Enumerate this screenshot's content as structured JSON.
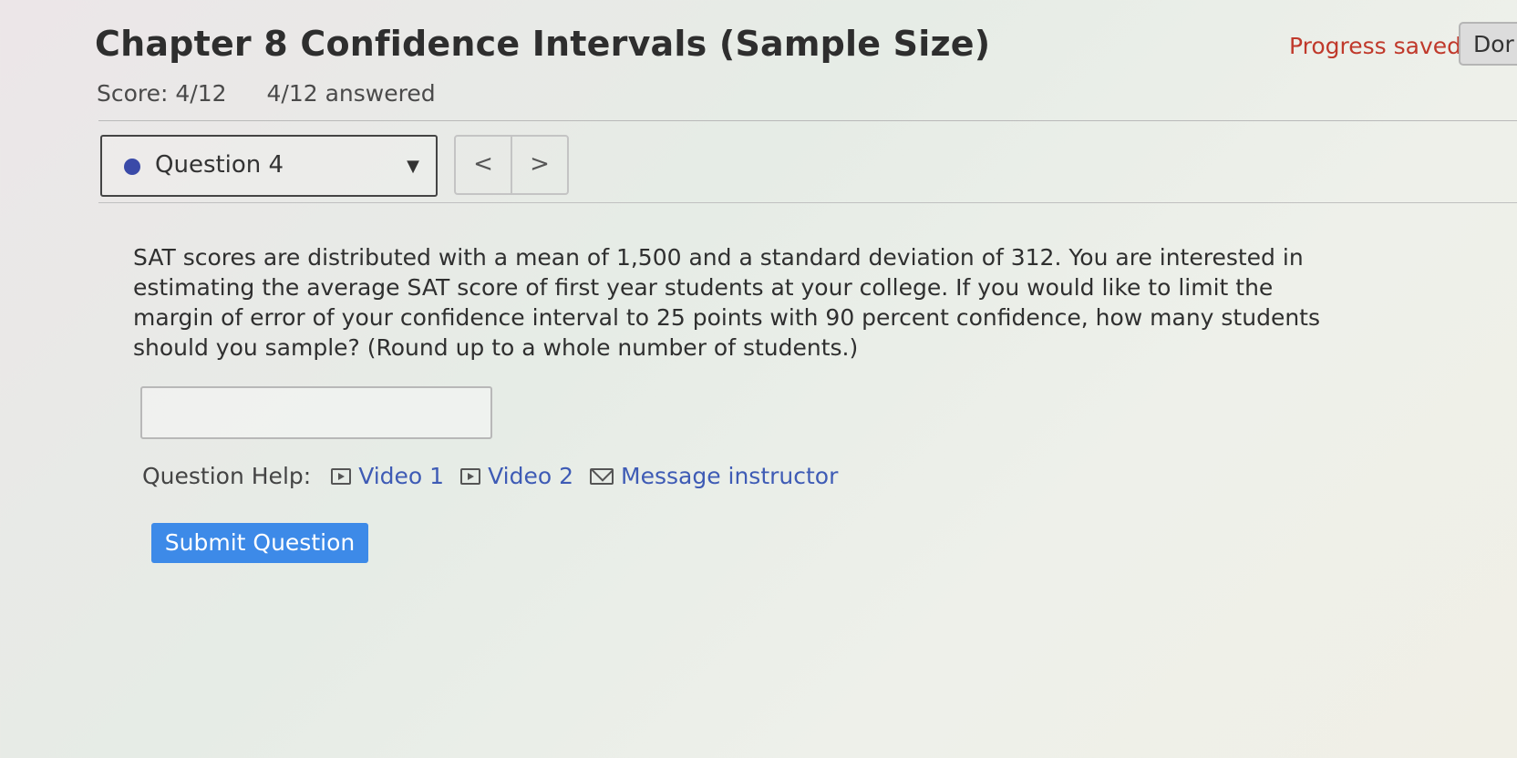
{
  "header": {
    "title": "Chapter 8 Confidence Intervals (Sample Size)",
    "score": "Score: 4/12",
    "answered": "4/12 answered",
    "progress_status": "Progress saved",
    "done_label": "Dor"
  },
  "question_nav": {
    "selected_question": "Question 4",
    "prev_label": "<",
    "next_label": ">"
  },
  "question": {
    "text": "SAT scores are distributed with a mean of 1,500 and a standard deviation of 312. You are interested in estimating the average SAT score of first year students at your college. If you would like to limit the margin of error of your confidence interval to 25 points with 90 percent confidence, how many students should you sample?  (Round up to a whole number of students.)",
    "answer_value": ""
  },
  "help": {
    "label": "Question Help:",
    "video1": "Video 1",
    "video2": "Video 2",
    "message": "Message instructor"
  },
  "actions": {
    "submit_label": "Submit Question"
  },
  "colors": {
    "accent": "#3d8ae8",
    "link": "#3e5bb5",
    "saved": "#c0392b",
    "question_dot": "#3a4aa8"
  },
  "icons": [
    "play-icon",
    "mail-icon",
    "caret-down-icon",
    "chevron-left-icon",
    "chevron-right-icon"
  ]
}
